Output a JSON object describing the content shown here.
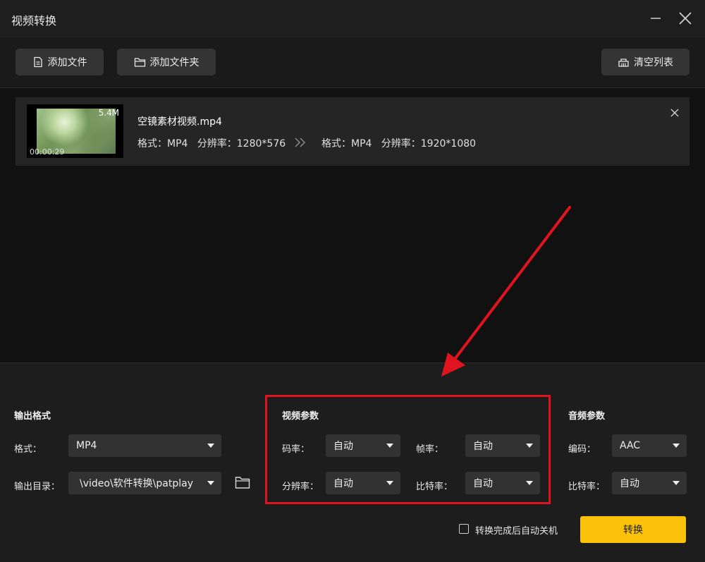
{
  "window": {
    "title": "视频转换"
  },
  "toolbar": {
    "add_file": "添加文件",
    "add_folder": "添加文件夹",
    "clear_list": "清空列表"
  },
  "file": {
    "name": "空镜素材视频.mp4",
    "size": "5.4M",
    "duration": "00:00:29",
    "source_info": "格式：MP4   分辨率：1280*576",
    "target_info": "格式：MP4   分辨率：1920*1080"
  },
  "output": {
    "section_title": "输出格式",
    "format_label": "格式：",
    "format_value": "MP4",
    "dir_label": "输出目录：",
    "dir_value": "\\video\\软件转换\\patplay"
  },
  "video_params": {
    "section_title": "视频参数",
    "bitrate_label": "码率：",
    "bitrate_value": "自动",
    "framerate_label": "帧率：",
    "framerate_value": "自动",
    "resolution_label": "分辨率：",
    "resolution_value": "自动",
    "bitrate2_label": "比特率：",
    "bitrate2_value": "自动"
  },
  "audio_params": {
    "section_title": "音频参数",
    "codec_label": "编码：",
    "codec_value": "AAC",
    "bitrate_label": "比特率：",
    "bitrate_value": "自动"
  },
  "footer": {
    "shutdown_label": "转换完成后自动关机",
    "shutdown_checked": false,
    "convert_button": "转换"
  },
  "colors": {
    "accent": "#fcc20a",
    "highlight": "#e0141e"
  }
}
